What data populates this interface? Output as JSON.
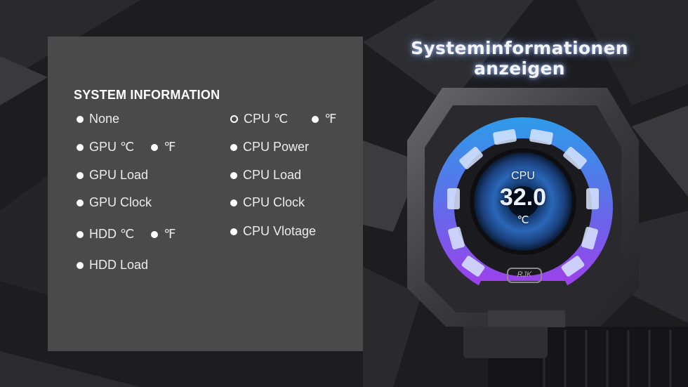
{
  "headline": "Systeminformationen anzeigen",
  "panel": {
    "title": "SYSTEM INFORMATION",
    "left_options": [
      {
        "label": "None"
      },
      {
        "label": "GPU ℃",
        "unit": "℉"
      },
      {
        "label": "GPU Load"
      },
      {
        "label": "GPU Clock"
      },
      {
        "label": "HDD ℃",
        "unit": "℉"
      },
      {
        "label": "HDD Load"
      }
    ],
    "right_options": [
      {
        "label": "CPU ℃",
        "unit": "℉",
        "selected": true
      },
      {
        "label": "CPU Power"
      },
      {
        "label": "CPU Load"
      },
      {
        "label": "CPU Clock"
      },
      {
        "label": "CPU Vlotage"
      }
    ]
  },
  "display": {
    "label": "CPU",
    "value": "32.0",
    "unit": "℃",
    "brand": "RJK"
  },
  "colors": {
    "panel": "#4a4a4a",
    "ring_blue": "#2ea8ff",
    "ring_purple": "#b43cff"
  }
}
